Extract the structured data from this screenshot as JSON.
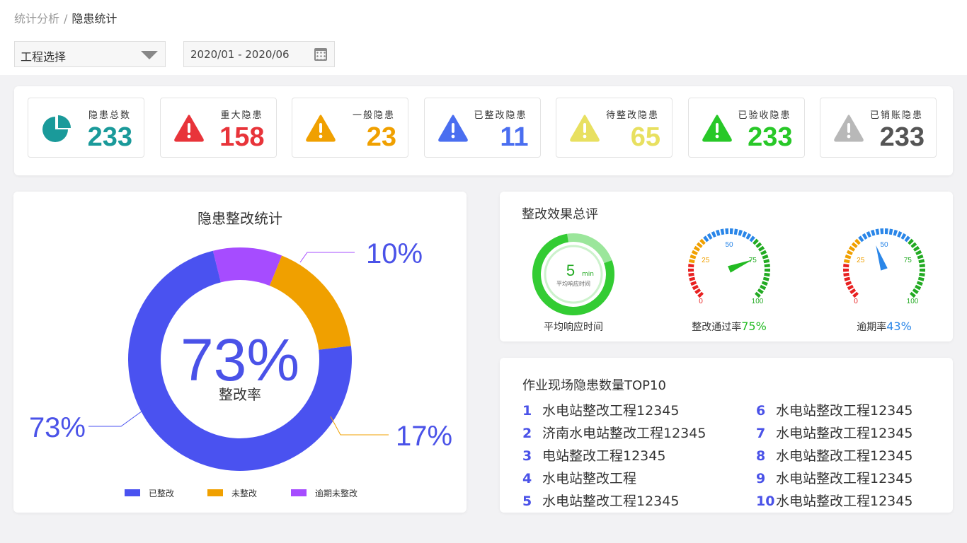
{
  "breadcrumb": {
    "parent": "统计分析",
    "separator": "/",
    "current": "隐患统计"
  },
  "filters": {
    "project_select": "工程选择",
    "date_range": "2020/01 - 2020/06"
  },
  "stats": [
    {
      "label": "隐患总数",
      "value": "233",
      "color": "#1a9a9a",
      "icon": "pie-chart-icon"
    },
    {
      "label": "重大隐患",
      "value": "158",
      "color": "#e8343a",
      "icon": "warning-icon"
    },
    {
      "label": "一般隐患",
      "value": "23",
      "color": "#f0a000",
      "icon": "warning-icon"
    },
    {
      "label": "已整改隐患",
      "value": "11",
      "color": "#4a6ef0",
      "icon": "warning-icon"
    },
    {
      "label": "待整改隐患",
      "value": "65",
      "color": "#e8e060",
      "icon": "warning-icon"
    },
    {
      "label": "已验收隐患",
      "value": "233",
      "color": "#28c828",
      "icon": "warning-icon"
    },
    {
      "label": "已销账隐患",
      "value": "233",
      "color": "#555555",
      "icon_color": "#b8b8b8",
      "icon": "warning-icon"
    }
  ],
  "donut": {
    "title": "隐患整改统计",
    "center_value": "73%",
    "center_label": "整改率",
    "legend": [
      {
        "name": "已整改",
        "color": "#4a52f0"
      },
      {
        "name": "未整改",
        "color": "#f0a000"
      },
      {
        "name": "逾期未整改",
        "color": "#a64cff"
      }
    ],
    "callouts": {
      "done": "73%",
      "undone": "17%",
      "overdue": "10%"
    }
  },
  "chart_data": {
    "type": "pie",
    "categories": [
      "已整改",
      "未整改",
      "逾期未整改"
    ],
    "values": [
      73,
      17,
      10
    ],
    "title": "隐患整改统计"
  },
  "evaluation": {
    "title": "整改效果总评",
    "response": {
      "value": "5",
      "unit": "min",
      "sub": "平均响应时间",
      "label": "平均响应时间",
      "ring_color": "#33cc33"
    },
    "pass_gauge": {
      "label": "整改通过率",
      "value_text": "75%",
      "value": 75,
      "value_color": "#22bb22",
      "ticks": [
        "0",
        "25",
        "50",
        "75",
        "100"
      ]
    },
    "overdue_gauge": {
      "label": "逾期率",
      "value_text": "43%",
      "value": 43,
      "value_color": "#2a86e8",
      "ticks": [
        "0",
        "25",
        "50",
        "75",
        "100"
      ]
    }
  },
  "top10": {
    "title": "作业现场隐患数量TOP10",
    "items": [
      {
        "rank": "1",
        "name": "水电站整改工程12345"
      },
      {
        "rank": "2",
        "name": "济南水电站整改工程12345"
      },
      {
        "rank": "3",
        "name": "电站整改工程12345"
      },
      {
        "rank": "4",
        "name": "水电站整改工程"
      },
      {
        "rank": "5",
        "name": "水电站整改工程12345"
      },
      {
        "rank": "6",
        "name": "水电站整改工程12345"
      },
      {
        "rank": "7",
        "name": "水电站整改工程12345"
      },
      {
        "rank": "8",
        "name": "水电站整改工程12345"
      },
      {
        "rank": "9",
        "name": "水电站整改工程12345"
      },
      {
        "rank": "10",
        "name": "水电站整改工程12345"
      }
    ]
  }
}
